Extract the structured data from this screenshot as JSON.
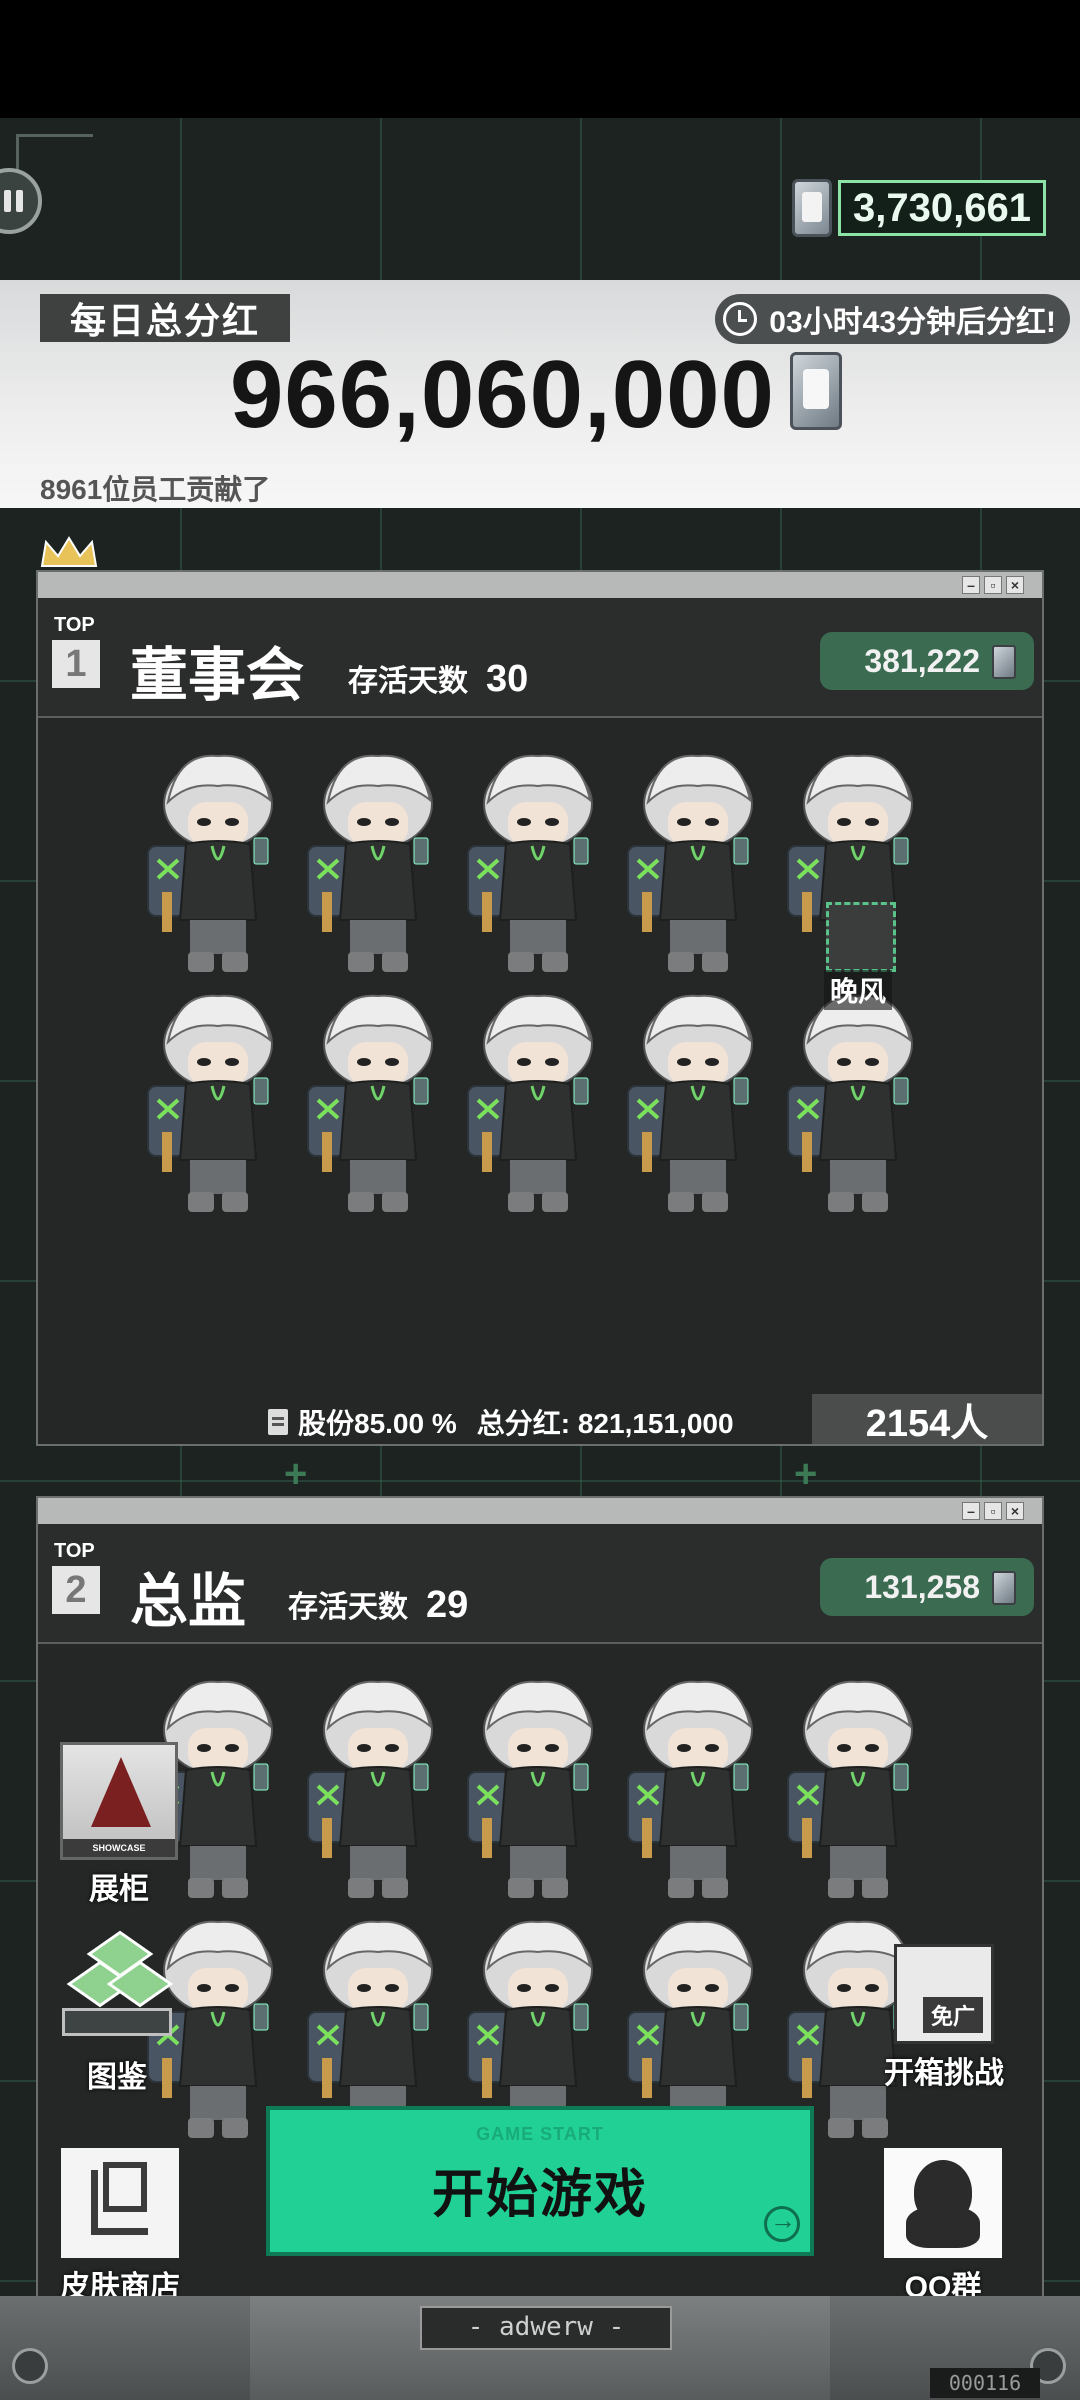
{
  "currency": {
    "value": "3,730,661",
    "icon": "card-coin-icon"
  },
  "banner": {
    "tag": "每日总分红",
    "timer": "03小时43分钟后分红!",
    "total": "966,060,000",
    "contributors": "8961位员工贡献了"
  },
  "panels": [
    {
      "top": "TOP",
      "rank": "1",
      "title": "董事会",
      "survive_label": "存活天数",
      "survive_days": "30",
      "reward": "381,222",
      "shares": "股份85.00 %",
      "total_dividend": "总分红: 821,151,000",
      "people": "2154人",
      "highlight_name": "晚风"
    },
    {
      "top": "TOP",
      "rank": "2",
      "title": "总监",
      "survive_label": "存活天数",
      "survive_days": "29",
      "reward": "131,258"
    }
  ],
  "side_buttons": {
    "showcase": {
      "label": "展柜",
      "badge": "SHOWCASE"
    },
    "collection": {
      "label": "图鉴"
    },
    "skin_shop": {
      "label": "皮肤商店"
    },
    "box_challenge": {
      "label": "开箱挑战",
      "tag": "免广"
    },
    "qq_group": {
      "label": "QQ群"
    }
  },
  "start": {
    "sub": "GAME START",
    "label": "开始游戏"
  },
  "device": {
    "label": "- adwerw -",
    "counter": "000116"
  },
  "colors": {
    "accent": "#21d095",
    "panel": "#242726",
    "pill": "#3b6b51"
  }
}
